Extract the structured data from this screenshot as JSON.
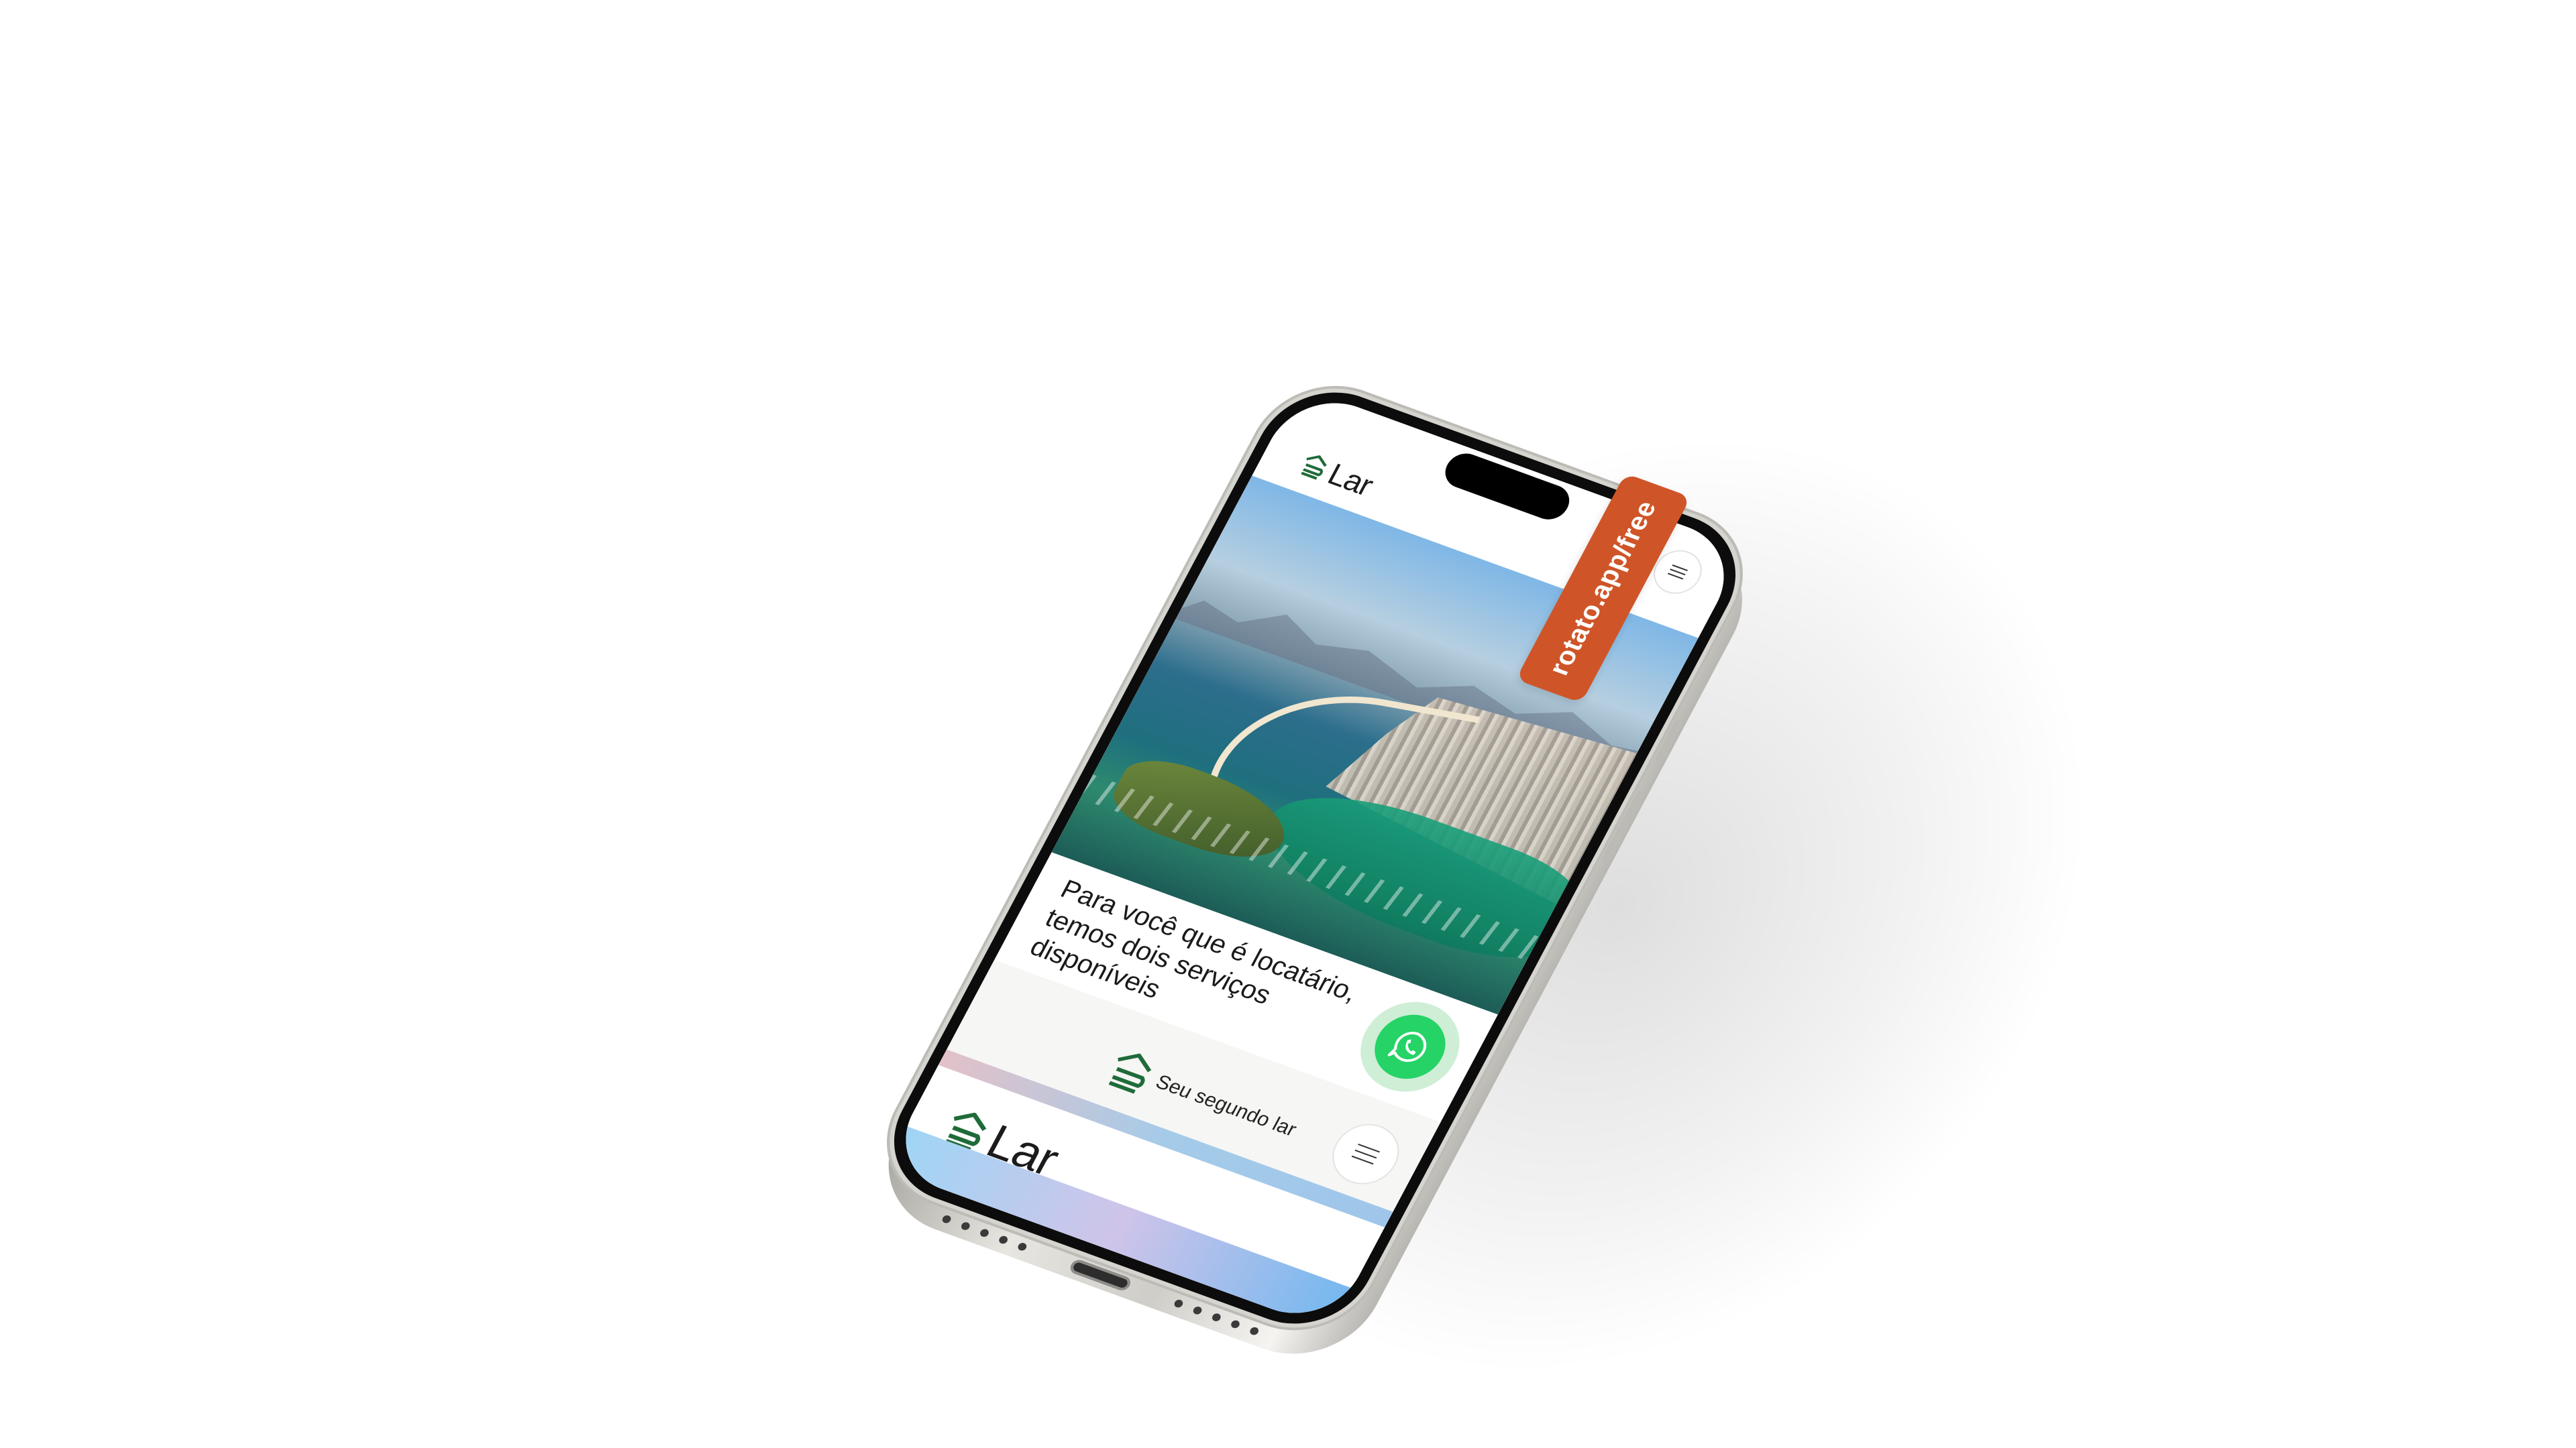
{
  "site": {
    "logo_text": "Lar",
    "headline_line1": "Para você que é locatário,",
    "headline_line2": "temos dois serviços disponíveis",
    "tagline": "Seu segundo lar",
    "preview_logo_text": "Lar"
  },
  "icons": {
    "logo": "house-stack-icon",
    "menu": "hamburger-menu-icon",
    "whatsapp": "whatsapp-icon"
  },
  "colors": {
    "brand_green": "#1f6b3a",
    "whatsapp_green": "#25d366",
    "whatsapp_halo": "#cfeed6",
    "tag_orange": "#cf5528"
  },
  "tag": {
    "text": "rotato.app/free"
  }
}
